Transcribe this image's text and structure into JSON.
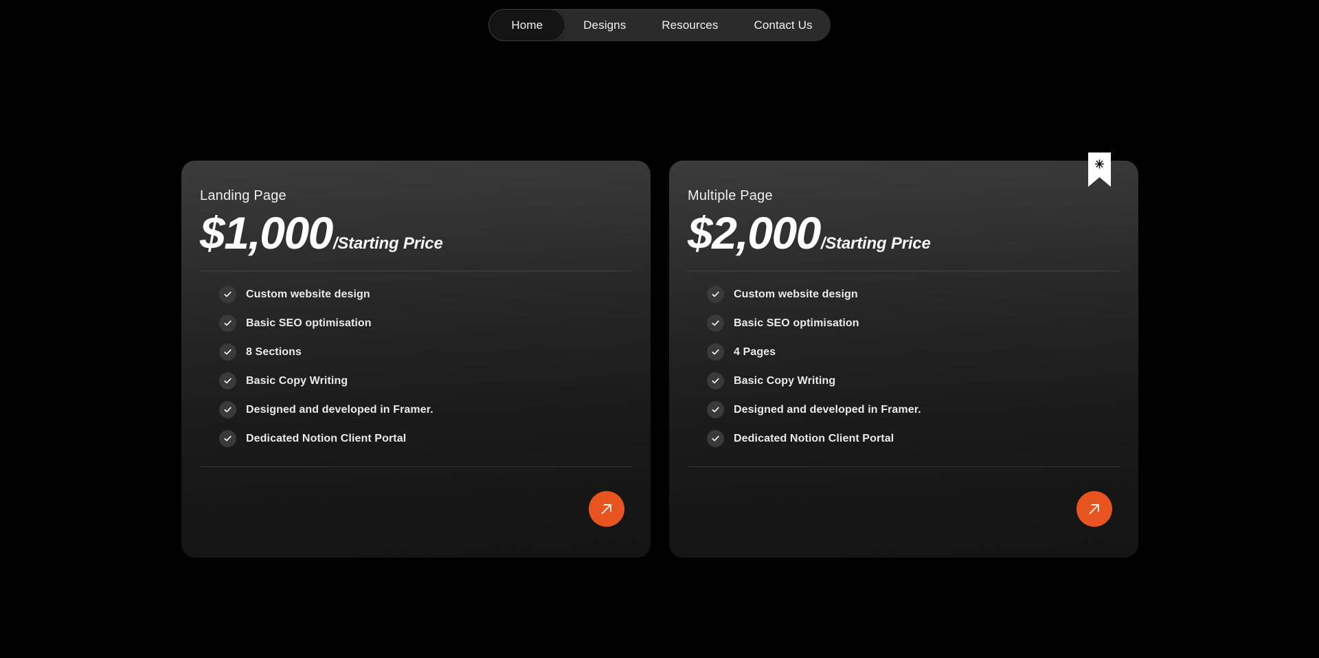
{
  "nav": {
    "items": [
      {
        "label": "Home",
        "active": true
      },
      {
        "label": "Designs",
        "active": false
      },
      {
        "label": "Resources",
        "active": false
      },
      {
        "label": "Contact Us",
        "active": false
      }
    ]
  },
  "colors": {
    "background": "#000000",
    "accent": "#e8541f",
    "nav_pill": "#2b2b2b",
    "nav_active": "#141414",
    "check_circle": "#3a3a3a",
    "ribbon": "#ffffff"
  },
  "cards": [
    {
      "title": "Landing Page",
      "price": "$1,000",
      "price_suffix": "/Starting Price",
      "featured": false,
      "features": [
        "Custom website design",
        "Basic SEO optimisation",
        "8 Sections",
        "Basic Copy Writing",
        "Designed and developed in Framer.",
        "Dedicated Notion Client Portal"
      ],
      "cta_icon": "arrow-up-right-icon"
    },
    {
      "title": "Multiple Page",
      "price": "$2,000",
      "price_suffix": "/Starting Price",
      "featured": true,
      "ribbon_glyph": "✳",
      "features": [
        "Custom website design",
        "Basic SEO optimisation",
        "4 Pages",
        "Basic Copy Writing",
        "Designed and developed in Framer.",
        "Dedicated Notion Client Portal"
      ],
      "cta_icon": "arrow-up-right-icon"
    }
  ]
}
